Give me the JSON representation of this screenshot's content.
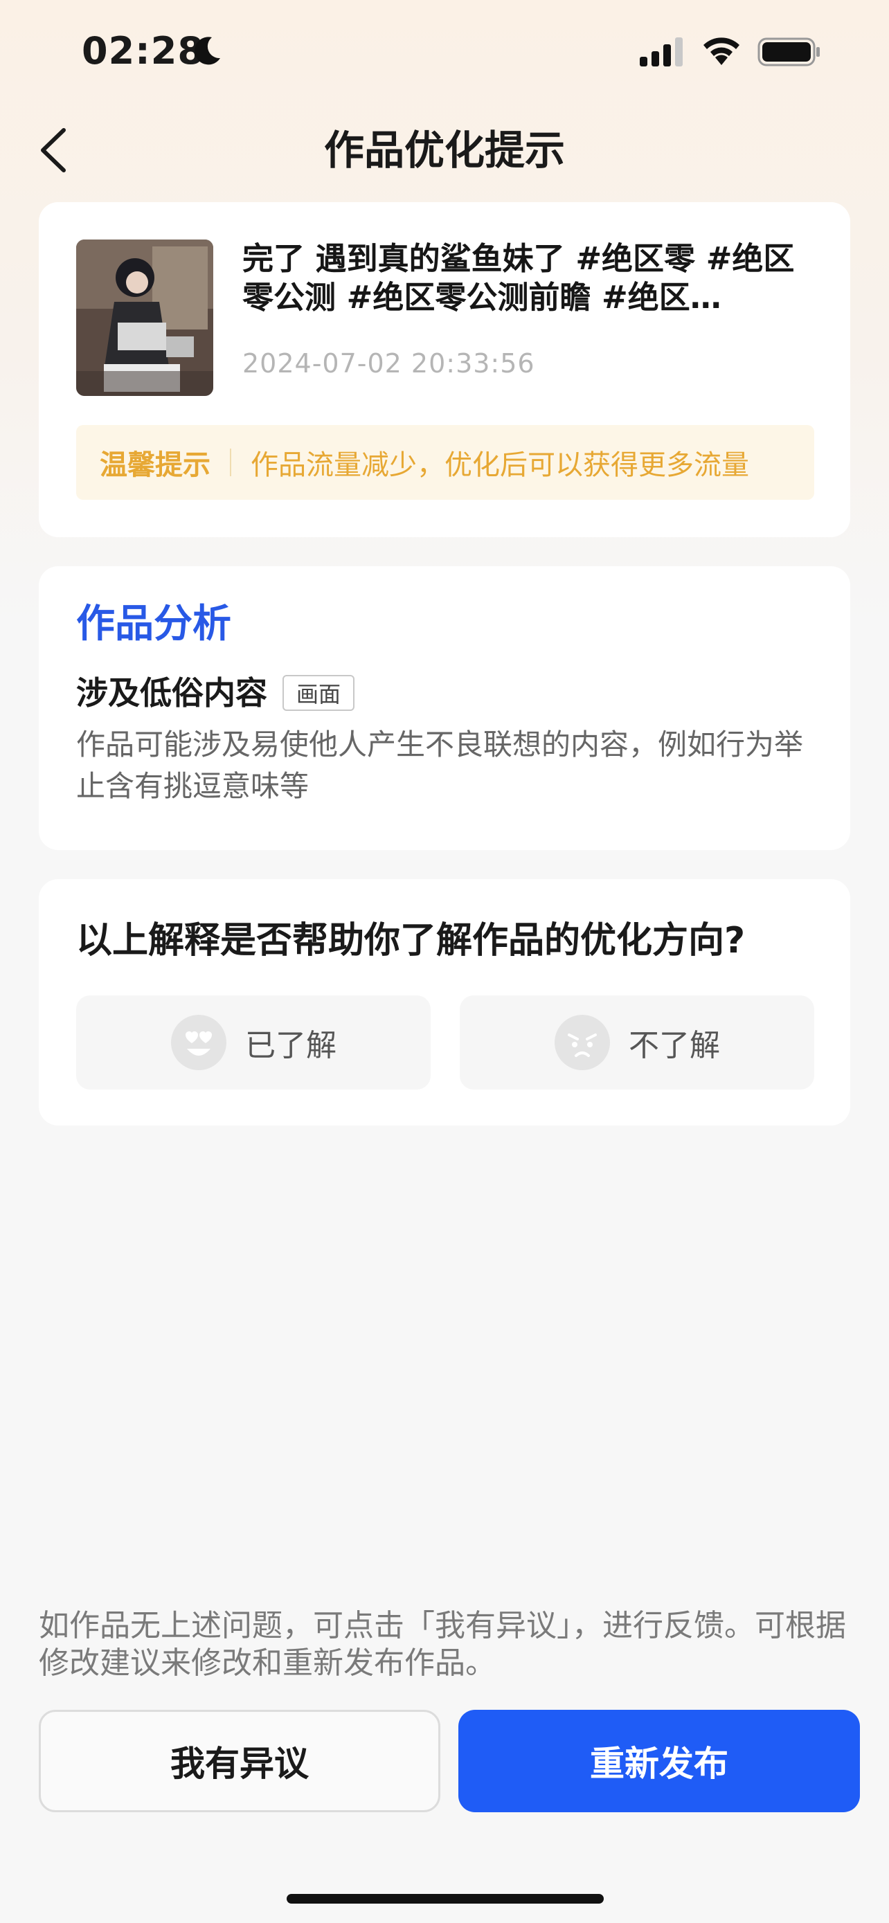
{
  "status_bar": {
    "time": "02:28",
    "icons": [
      "moon-icon",
      "cellular-signal-icon",
      "wifi-icon",
      "battery-icon"
    ]
  },
  "nav": {
    "back_icon": "chevron-left-icon",
    "title": "作品优化提示"
  },
  "post": {
    "title": "完了 遇到真的鲨鱼妹了 #绝区零 #绝区零公测 #绝区零公测前瞻 #绝区…",
    "date": "2024-07-02 20:33:56",
    "tip_label": "温馨提示",
    "tip_text": "作品流量减少，优化后可以获得更多流量"
  },
  "analysis": {
    "heading": "作品分析",
    "issue_title": "涉及低俗内容",
    "issue_tag": "画面",
    "issue_desc": "作品可能涉及易使他人产生不良联想的内容，例如行为举止含有挑逗意味等"
  },
  "feedback": {
    "question": "以上解释是否帮助你了解作品的优化方向?",
    "understood_label": "已了解",
    "not_understood_label": "不了解"
  },
  "bottom": {
    "notice": "如作品无上述问题，可点击「我有异议」，进行反馈。可根据修改建议来修改和重新发布作品。",
    "dispute_label": "我有异议",
    "republish_label": "重新发布"
  },
  "colors": {
    "accent_blue": "#1f5cf6",
    "heading_blue": "#2859e6",
    "tip_orange": "#e7a834",
    "tip_bg": "#fdf6e7"
  }
}
